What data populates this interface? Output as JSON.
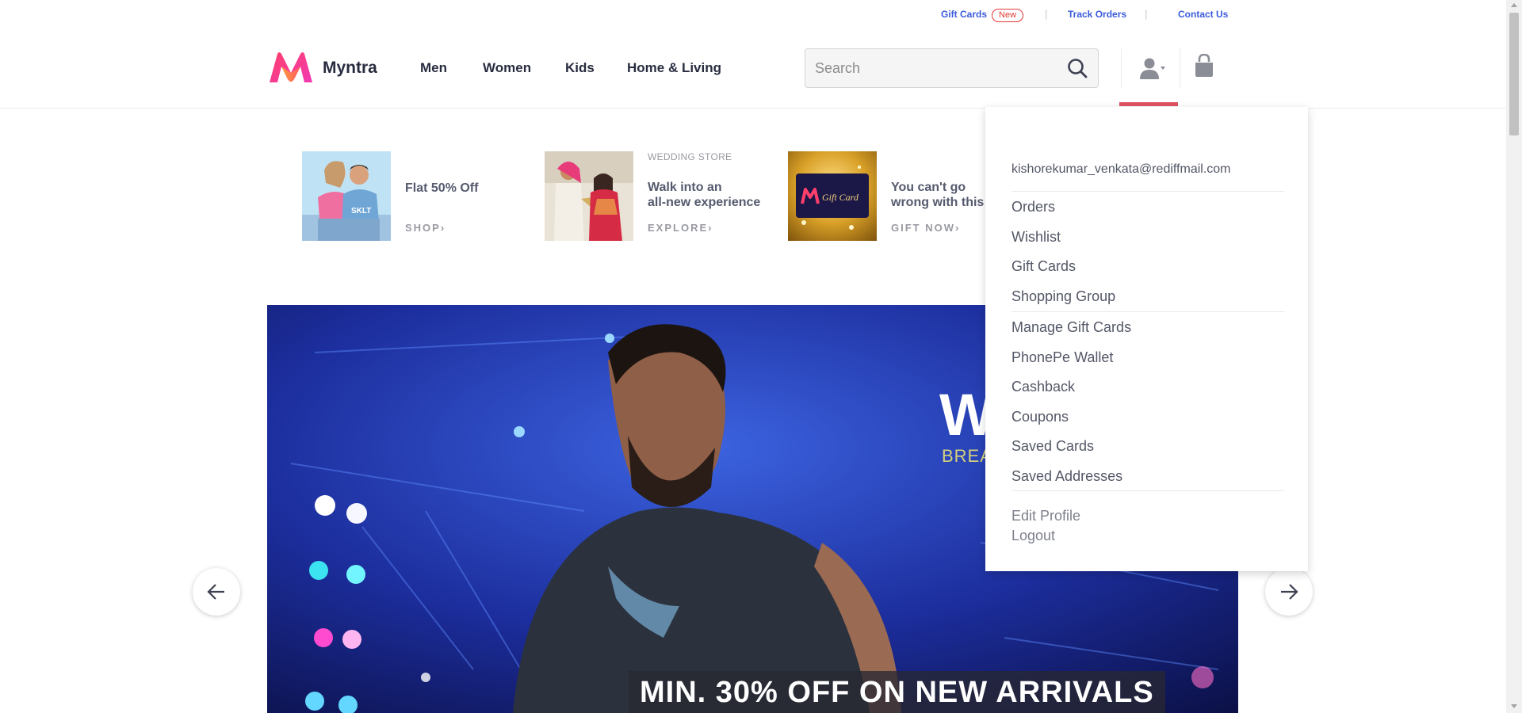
{
  "utility_bar": {
    "gift_cards": "Gift Cards",
    "new_badge": "New",
    "track_orders": "Track Orders",
    "contact_us": "Contact Us"
  },
  "header": {
    "brand": "Myntra",
    "nav": [
      "Men",
      "Women",
      "Kids",
      "Home & Living"
    ],
    "search_placeholder": "Search"
  },
  "promos": [
    {
      "small": "",
      "title": "Flat 50% Off",
      "cta": "SHOP"
    },
    {
      "small": "WEDDING STORE",
      "title_line1": "Walk into an",
      "title_line2": "all-new experience",
      "cta": "EXPLORE"
    },
    {
      "small": "",
      "title_line1": "You can't go",
      "title_line2": "wrong with this",
      "cta": "GIFT NOW",
      "card_text": "Gift Card"
    }
  ],
  "hero": {
    "headline": "MIN. 30% OFF ON NEW ARRIVALS",
    "partial_big": "W",
    "partial_small": "BREA"
  },
  "profile_menu": {
    "email": "kishorekumar_venkata@rediffmail.com",
    "group1": [
      "Orders",
      "Wishlist",
      "Gift Cards",
      "Shopping Group"
    ],
    "group2": [
      "Manage Gift Cards",
      "PhonePe Wallet",
      "Cashback",
      "Coupons",
      "Saved Cards",
      "Saved Addresses"
    ],
    "group3": [
      "Edit Profile",
      "Logout"
    ]
  },
  "colors": {
    "link_blue": "#3b5bdb",
    "accent_red": "#e05263",
    "text_dark": "#282c3f"
  }
}
